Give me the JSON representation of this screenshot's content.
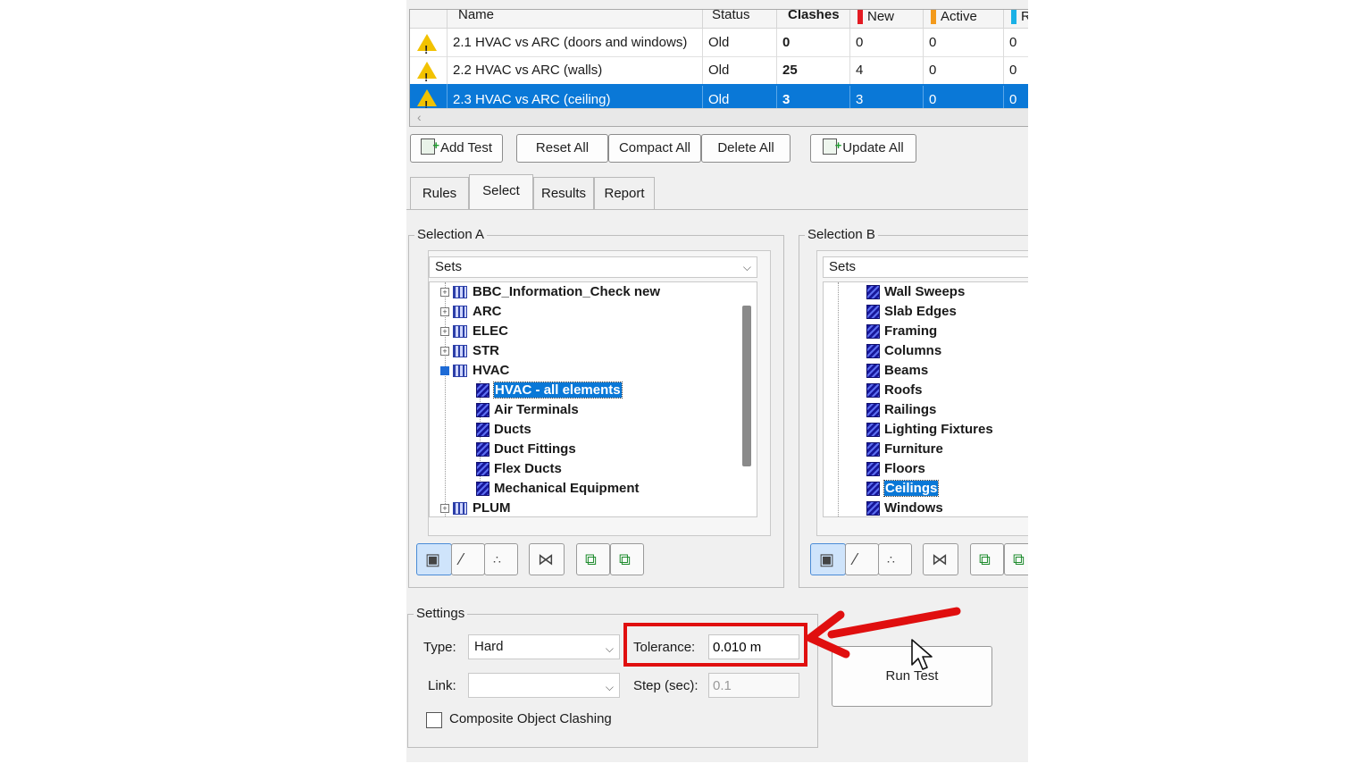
{
  "tests_table": {
    "headers": {
      "name": "Name",
      "status": "Status",
      "clashes": "Clashes",
      "new": "New",
      "active": "Active",
      "reviewed": "R"
    },
    "header_colors": {
      "new": "#e31b23",
      "active": "#f39a1b",
      "reviewed": "#1ab1e6"
    },
    "rows": [
      {
        "name": "2.1 HVAC vs ARC (doors and windows)",
        "status": "Old",
        "clashes": "0",
        "new": "0",
        "active": "0",
        "reviewed": "0"
      },
      {
        "name": "2.2 HVAC vs ARC (walls)",
        "status": "Old",
        "clashes": "25",
        "new": "4",
        "active": "0",
        "reviewed": "0"
      },
      {
        "name": "2.3 HVAC vs ARC (ceiling)",
        "status": "Old",
        "clashes": "3",
        "new": "3",
        "active": "0",
        "reviewed": "0"
      }
    ],
    "scroll_left_glyph": "‹"
  },
  "toolbar": {
    "add_test": "Add Test",
    "reset_all": "Reset All",
    "compact_all": "Compact All",
    "delete_all": "Delete All",
    "update_all": "Update All"
  },
  "tabs": [
    "Rules",
    "Select",
    "Results",
    "Report"
  ],
  "active_tab": "Select",
  "selection_a": {
    "title": "Selection A",
    "dropdown": "Sets",
    "tree": {
      "bbc": "BBC_Information_Check new",
      "arc": "ARC",
      "elec": "ELEC",
      "str": "STR",
      "hvac": "HVAC",
      "hvac_all": "HVAC - all elements",
      "air": "Air Terminals",
      "ducts": "Ducts",
      "duct_fittings": "Duct Fittings",
      "flex": "Flex Ducts",
      "mech": "Mechanical Equipment",
      "plum": "PLUM"
    }
  },
  "selection_b": {
    "title": "Selection B",
    "dropdown": "Sets",
    "tree": {
      "wall_sweeps": "Wall Sweeps",
      "slab_edges": "Slab Edges",
      "framing": "Framing",
      "columns": "Columns",
      "beams": "Beams",
      "roofs": "Roofs",
      "railings": "Railings",
      "lighting": "Lighting Fixtures",
      "furniture": "Furniture",
      "floors": "Floors",
      "ceilings": "Ceilings",
      "windows": "Windows"
    }
  },
  "settings": {
    "title": "Settings",
    "type_label": "Type:",
    "type_value": "Hard",
    "tolerance_label": "Tolerance:",
    "tolerance_value": "0.010 m",
    "link_label": "Link:",
    "link_value": "",
    "step_label": "Step (sec):",
    "step_value": "0.1",
    "composite_label": "Composite Object Clashing"
  },
  "run_test": "Run Test",
  "icons": {
    "warning": "warning-icon",
    "add": "add-test-icon",
    "update": "update-all-icon",
    "set": "selection-set-icon",
    "expand": "expand-icon",
    "collapse": "collapse-icon",
    "chevron": "chevron-down-icon",
    "cursor": "mouse-cursor-icon",
    "arrow": "annotation-arrow"
  },
  "colors": {
    "selection": "#0a78d7",
    "highlight_box": "#e00f0f",
    "set_icon": "#17179a"
  }
}
